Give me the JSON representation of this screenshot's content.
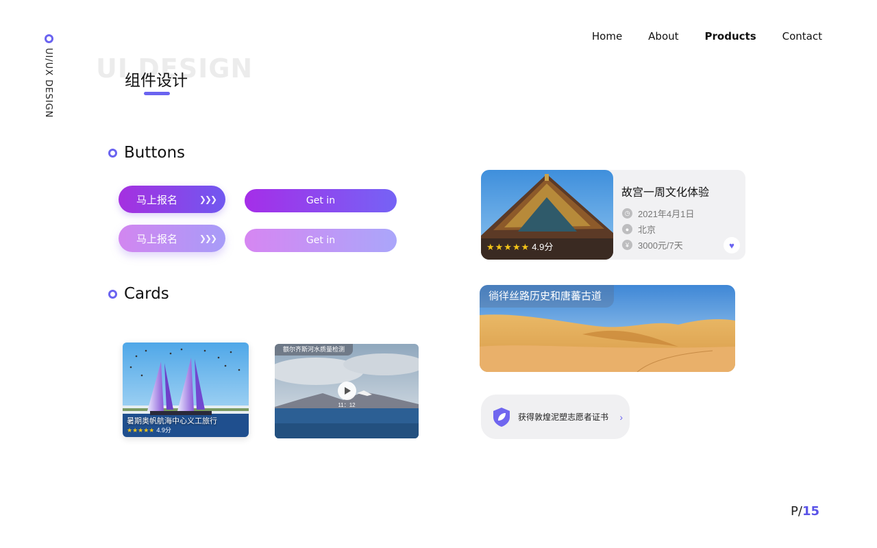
{
  "side": {
    "label": "UI/UX DESIGN"
  },
  "nav": {
    "items": [
      "Home",
      "About",
      "Products",
      "Contact"
    ]
  },
  "header": {
    "bg_title": "UI DESIGN",
    "title": "组件设计"
  },
  "sections": {
    "buttons": "Buttons",
    "cards": "Cards"
  },
  "buttons": {
    "primary_cn": "马上报名",
    "light_cn": "马上报名",
    "primary_en": "Get in",
    "light_en": "Get in"
  },
  "card_sail": {
    "caption": "暑期奥帆航海中心义工旅行",
    "stars": "★★★★★",
    "rating": "4.9分"
  },
  "card_lake": {
    "tag": "额尔齐斯河水质量检测",
    "duration": "11：12"
  },
  "card_palace": {
    "title": "故宫一周文化体验",
    "date": "2021年4月1日",
    "location": "北京",
    "price": "3000元/7天",
    "stars": "★★★★★",
    "rating": "4.9分"
  },
  "card_desert": {
    "tag": "徜徉丝路历史和唐蕃古道"
  },
  "certificate": {
    "text": "获得敦煌泥塑志愿者证书"
  },
  "pager": {
    "prefix": "P/",
    "page": "15"
  },
  "colors": {
    "accent": "#6a63f0",
    "primary_gradient_start": "#a530e0",
    "primary_gradient_end": "#7058f0"
  },
  "icons": [
    "clock-icon",
    "location-pin-icon",
    "yen-icon",
    "heart-icon",
    "play-icon",
    "shield-leaf-icon",
    "chevron-right-icon",
    "double-chevron-icon"
  ]
}
